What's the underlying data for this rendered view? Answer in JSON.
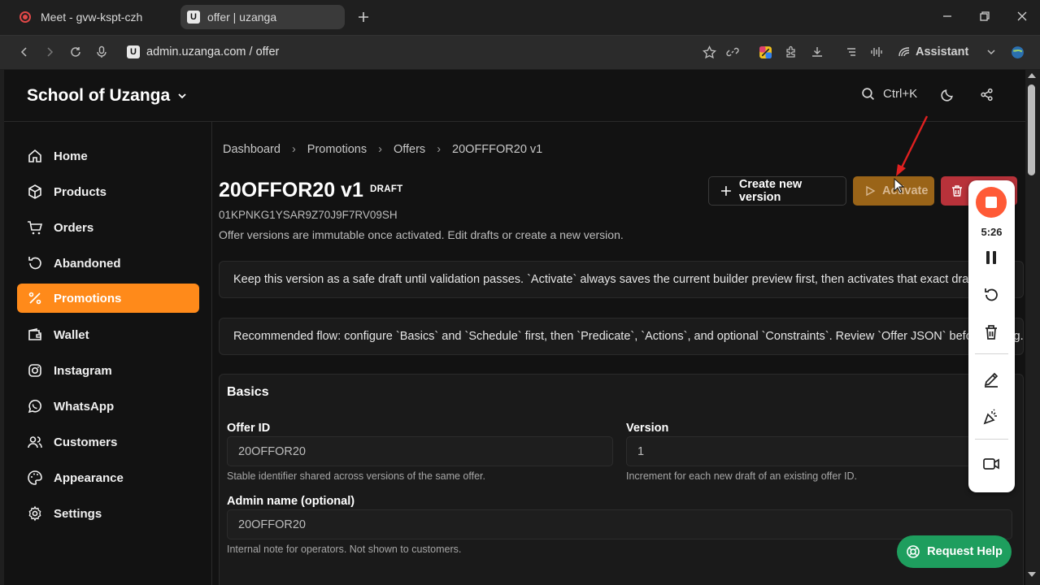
{
  "browser": {
    "tabs": [
      {
        "title": "Meet - gvw-kspt-czh",
        "icon": "recording-icon"
      },
      {
        "title": "offer | uzanga",
        "icon": "uzanga-favicon",
        "active": true
      }
    ],
    "favicon_letter": "U",
    "url": "admin.uzanga.com / offer",
    "assistant_label": "Assistant"
  },
  "header": {
    "brand": "School of Uzanga",
    "search_shortcut": "Ctrl+K"
  },
  "sidebar": {
    "items": [
      {
        "label": "Home",
        "icon": "home-icon"
      },
      {
        "label": "Products",
        "icon": "box-icon"
      },
      {
        "label": "Orders",
        "icon": "cart-icon"
      },
      {
        "label": "Abandoned",
        "icon": "restore-icon"
      },
      {
        "label": "Promotions",
        "icon": "percent-icon",
        "active": true
      },
      {
        "label": "Wallet",
        "icon": "wallet-icon"
      },
      {
        "label": "Instagram",
        "icon": "instagram-icon"
      },
      {
        "label": "WhatsApp",
        "icon": "whatsapp-icon"
      },
      {
        "label": "Customers",
        "icon": "users-icon"
      },
      {
        "label": "Appearance",
        "icon": "palette-icon"
      },
      {
        "label": "Settings",
        "icon": "gear-icon"
      }
    ]
  },
  "main": {
    "breadcrumbs": [
      "Dashboard",
      "Promotions",
      "Offers",
      "20OFFFOR20 v1"
    ],
    "title": "20OFFOR20 v1",
    "status_badge": "DRAFT",
    "offer_key": "01KPNKG1YSAR9Z70J9F7RV09SH",
    "subtitle": "Offer versions are immutable once activated. Edit drafts or create a new version.",
    "buttons": {
      "create_version": "Create new version",
      "activate": "Activate",
      "delete": ""
    },
    "notes": [
      "Keep this version as a safe draft until validation passes. `Activate` always saves the current builder preview first, then activates that exact draft.",
      "Recommended flow: configure `Basics` and `Schedule` first, then `Predicate`, `Actions`, and optional `Constraints`. Review `Offer JSON` before saving."
    ],
    "basics": {
      "title": "Basics",
      "offer_id_label": "Offer ID",
      "offer_id_value": "20OFFOR20",
      "offer_id_help": "Stable identifier shared across versions of the same offer.",
      "version_label": "Version",
      "version_value": "1",
      "version_help": "Increment for each new draft of an existing offer ID.",
      "admin_name_label": "Admin name (optional)",
      "admin_name_value": "20OFFOR20",
      "admin_name_help": "Internal note for operators. Not shown to customers."
    }
  },
  "recorder": {
    "elapsed": "5:26"
  },
  "request_help_label": "Request Help",
  "colors": {
    "accent": "#ff8a1a",
    "activate_bg": "#9a6418",
    "delete_bg": "#b8323a",
    "help_bg": "#1e9e5e",
    "record": "#ff5a36",
    "annotation": "#e02020"
  }
}
